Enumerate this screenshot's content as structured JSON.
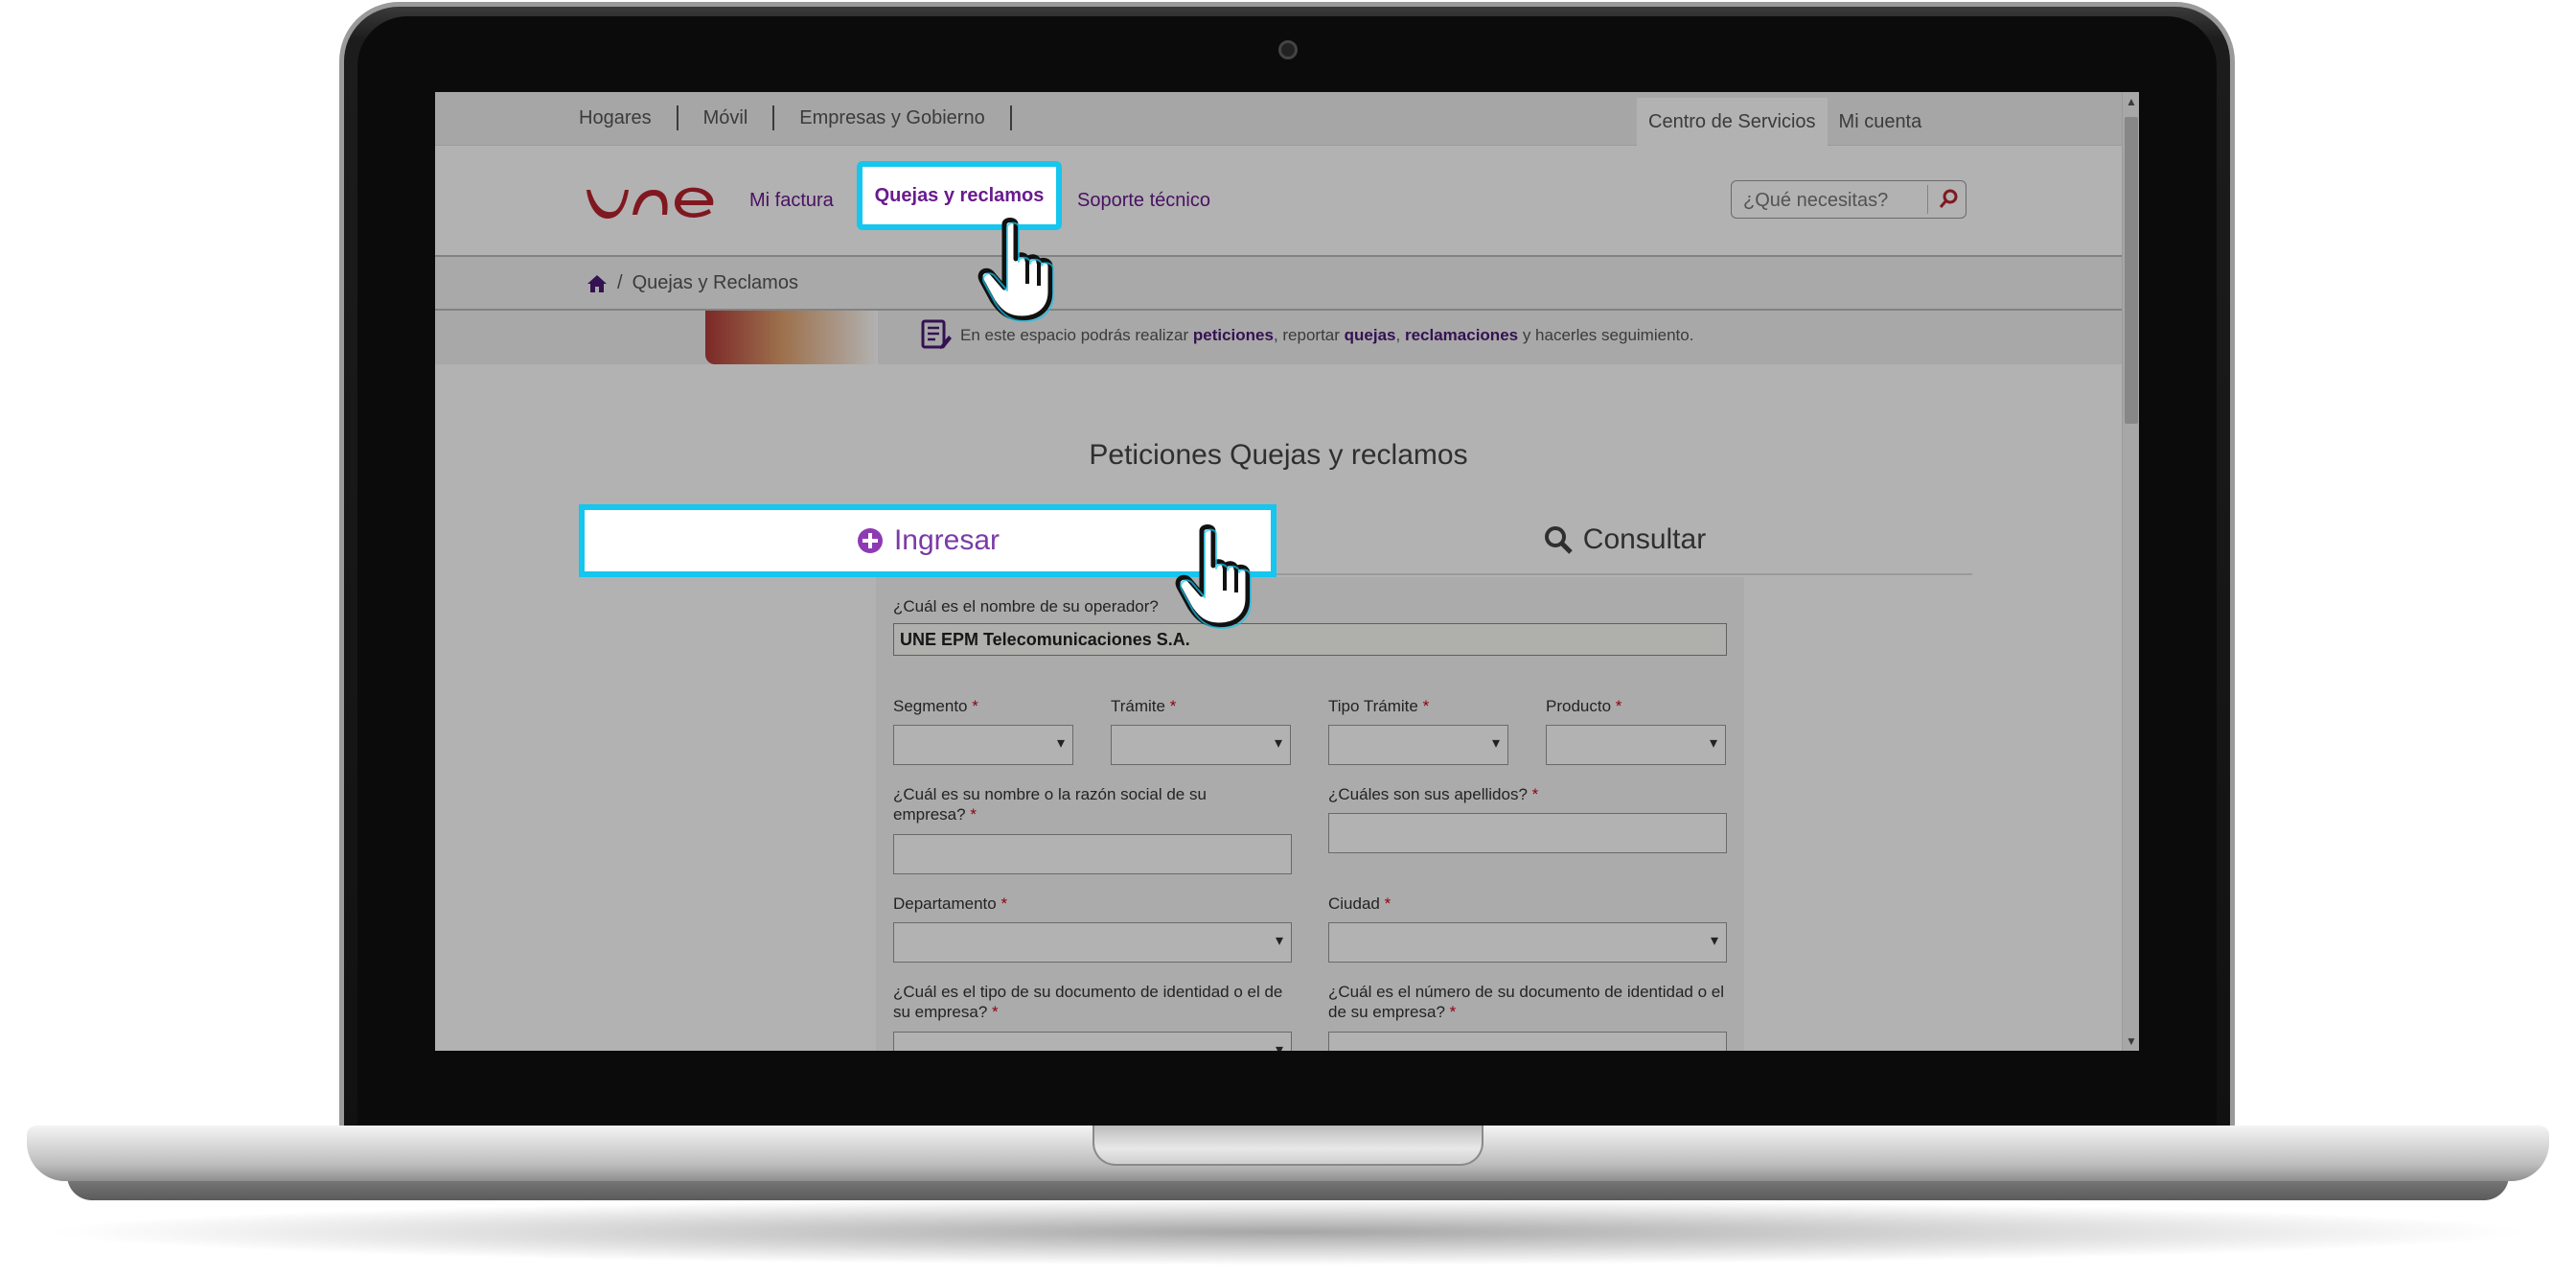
{
  "top_nav": {
    "items": [
      "Hogares",
      "Móvil",
      "Empresas y Gobierno"
    ],
    "right_tabs": [
      "Centro de Servicios",
      "Mi cuenta"
    ]
  },
  "main_nav": {
    "links": [
      "Mi factura",
      "Quejas y reclamos",
      "Soporte técnico"
    ],
    "active": "Quejas y reclamos"
  },
  "search": {
    "placeholder": "¿Qué necesitas?"
  },
  "breadcrumb": {
    "current": "Quejas y Reclamos"
  },
  "banner": {
    "text_1": "En este espacio podrás realizar ",
    "bold_1": "peticiones",
    "text_2": ", reportar ",
    "bold_2": "quejas",
    "text_3": ", ",
    "bold_3": "reclamaciones",
    "text_4": " y hacerles seguimiento."
  },
  "page": {
    "title": "Peticiones Quejas y reclamos"
  },
  "tabs": {
    "ingresar": "Ingresar",
    "consultar": "Consultar"
  },
  "form": {
    "operator_label": "¿Cuál es el nombre de su operador?",
    "operator_value": "UNE EPM Telecomunicaciones S.A.",
    "segmento": "Segmento",
    "tramite": "Trámite",
    "tipo_tramite": "Tipo Trámite",
    "producto": "Producto",
    "nombre_label": "¿Cuál es su nombre o la razón social de su empresa?",
    "apellidos_label": "¿Cuáles son sus apellidos?",
    "departamento": "Departamento",
    "ciudad": "Ciudad",
    "tipo_doc_label": "¿Cuál es el tipo de su documento de identidad o el de su empresa?",
    "num_doc_label": "¿Cuál es el número de su documento de identidad o el de su empresa?",
    "required_mark": "*"
  },
  "colors": {
    "accent": "#15c6ee",
    "brand": "#6a1b8f",
    "logo_red": "#b8232f"
  }
}
